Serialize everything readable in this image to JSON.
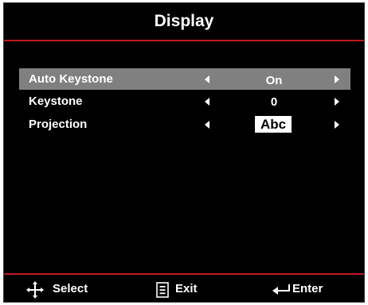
{
  "menu": {
    "title": "Display",
    "accent_color": "#c0191e",
    "items": [
      {
        "label": "Auto Keystone",
        "value": "On",
        "selected": true
      },
      {
        "label": "Keystone",
        "value": "0",
        "selected": false
      },
      {
        "label": "Projection",
        "value": "Abc",
        "selected": false,
        "value_style": "boxed"
      }
    ]
  },
  "footer": {
    "select": {
      "icon": "four-way-arrows-icon",
      "label": "Select"
    },
    "exit": {
      "icon": "menu-icon",
      "label": "Exit"
    },
    "enter": {
      "icon": "enter-arrow-icon",
      "label": "Enter"
    }
  }
}
